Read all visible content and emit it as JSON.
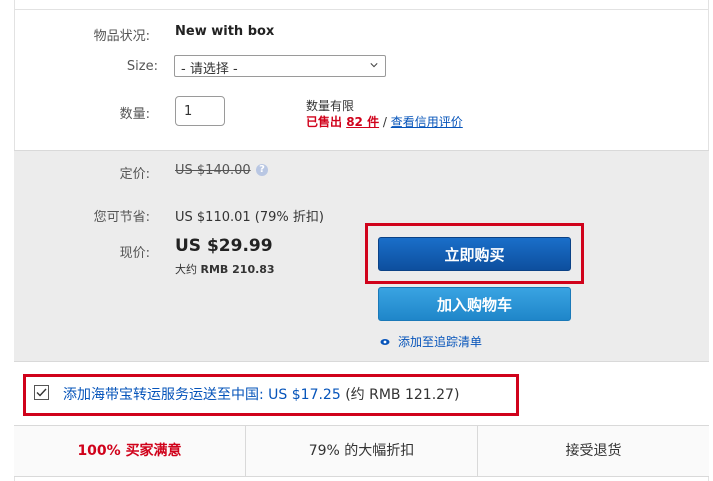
{
  "item": {
    "condition_label": "物品状况:",
    "condition_value": "New with box",
    "size_label": "Size:",
    "size_selected": "- 请选择 -",
    "qty_label": "数量:",
    "qty_value": "1",
    "qty_limited": "数量有限",
    "sold_prefix": "已售出 ",
    "sold_count": "82 件",
    "sold_sep": " / ",
    "credit_link": "查看信用评价"
  },
  "price": {
    "list_label": "定价:",
    "list_value": "US $140.00",
    "savings_label": "您可节省:",
    "savings_value": "US $110.01 (79% 折扣)",
    "now_label": "现价:",
    "now_value": "US $29.99",
    "approx_prefix": "大约 ",
    "approx_value": "RMB 210.83"
  },
  "buttons": {
    "buy_now": "立即购买",
    "add_cart": "加入购物车",
    "watch": "添加至追踪清单"
  },
  "shipping": {
    "text": "添加海带宝转运服务运送至中国:  US $17.25",
    "approx": "  (约 RMB 121.27)",
    "checked": true
  },
  "badges": [
    "100% 买家满意",
    "79% 的大幅折扣",
    "接受退货"
  ],
  "colors": {
    "accent_red": "#d0021b",
    "link_blue": "#0654ba",
    "buy_blue": "#0d4f9e"
  }
}
